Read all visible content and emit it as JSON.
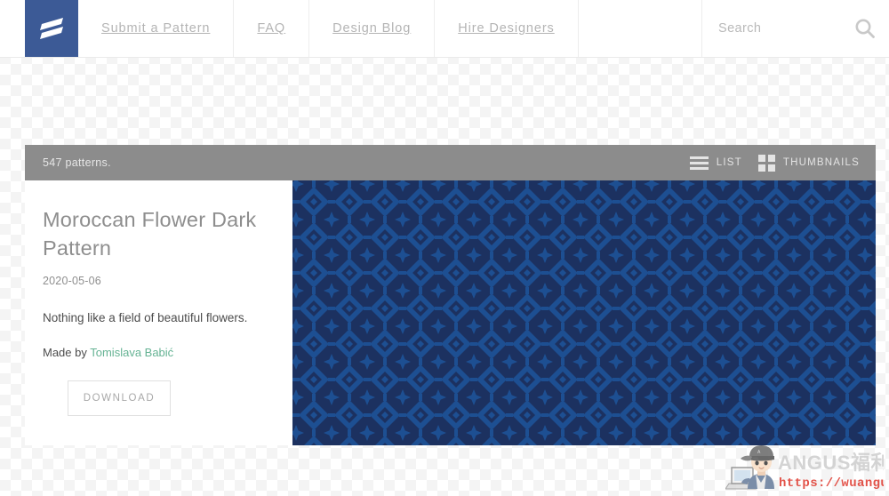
{
  "header": {
    "logo": {
      "icon": "equals-slant-logo-icon",
      "background_color": "#3c5a96"
    },
    "nav_items": [
      {
        "label": "Submit a Pattern",
        "name": "nav-item-submit-a-pattern"
      },
      {
        "label": "FAQ",
        "name": "nav-item-faq"
      },
      {
        "label": "Design Blog",
        "name": "nav-item-design-blog"
      },
      {
        "label": "Hire Designers",
        "name": "nav-item-hire-designers"
      }
    ],
    "search": {
      "placeholder": "Search",
      "value": "",
      "icon": "search-icon"
    }
  },
  "toolbar": {
    "count_text": "547 patterns.",
    "views": [
      {
        "label": "LIST",
        "icon": "list-icon",
        "name": "view-toggle-list"
      },
      {
        "label": "THUMBNAILS",
        "icon": "grid-icon",
        "name": "view-toggle-thumbnails"
      }
    ]
  },
  "detail": {
    "title": "Moroccan Flower Dark Pattern",
    "date": "2020-05-06",
    "description": "Nothing like a field of beautiful flowers.",
    "made_by_prefix": "Made by ",
    "author": "Tomislava Babić",
    "author_color": "#66b394",
    "download_label": "DOWNLOAD"
  },
  "swatch": {
    "name": "moroccan-flower-dark-pattern-preview",
    "base_color": "#1c3160",
    "motif_color": "#1d4f92",
    "tile_size_px": 40
  },
  "watermark": {
    "brand_text": "ANGUS福利社",
    "url_text": "https://wuangus.cc",
    "url_color": "#e03c31",
    "brand_color": "#cfcfcf"
  }
}
